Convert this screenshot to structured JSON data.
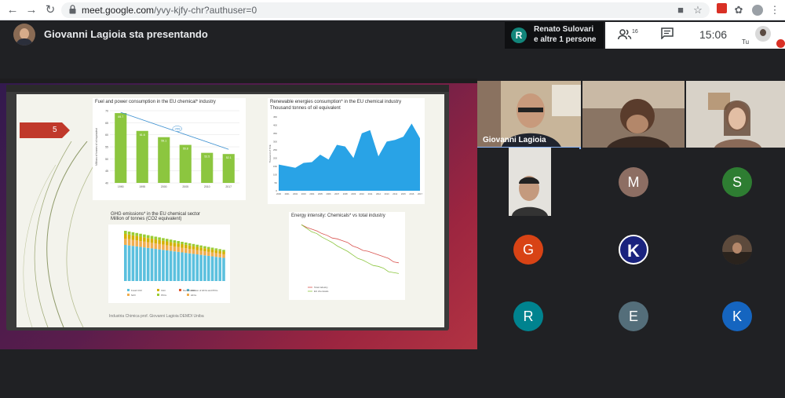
{
  "browser": {
    "url_host": "meet.google.com",
    "url_path": "/yvy-kjfy-chr?authuser=0"
  },
  "header": {
    "presenting_text": "Giovanni Lagioia sta presentando",
    "people_card": {
      "initial": "R",
      "line1": "Renato Sulovari",
      "line2": "e altre 1 persone"
    },
    "participants_count": "16",
    "clock": "15:06",
    "you_label": "Tu"
  },
  "slide": {
    "number": "5",
    "footer": "Industria Chimica   prof. Giovanni Lagioia DEMDI   Uniba",
    "charts": [
      {
        "type": "bar",
        "title": "Fuel and power consumption in the EU chemical* industry",
        "ylabel": "Millions of tonnes of oil equivalent",
        "categories": [
          "1990",
          "1995",
          "2000",
          "2005",
          "2010",
          "2017"
        ],
        "values": [
          69,
          61.6,
          59,
          55.8,
          52.5,
          52
        ],
        "ylim": [
          40,
          70
        ],
        "yticks": [
          "70",
          "65",
          "60",
          "55",
          "50",
          "45",
          "40"
        ],
        "bar_labels": [
          "69.7",
          "61.6",
          "59.1",
          "55.8",
          "52.5",
          "52.1"
        ],
        "color": "#8cc63f",
        "trend_label": "-25%"
      },
      {
        "type": "area",
        "title": "Renewable energies consumption* in the EU chemical industry",
        "subtitle": "Thousand tonnes of oil equivalent",
        "ylabel": "Thousand of TOE",
        "x": [
          "2000",
          "2001",
          "2002",
          "2003",
          "2004",
          "2005",
          "2006",
          "2007",
          "2008",
          "2009",
          "2010",
          "2011",
          "2012",
          "2013",
          "2014",
          "2015",
          "2016",
          "2017"
        ],
        "values": [
          160,
          150,
          140,
          170,
          175,
          220,
          190,
          280,
          270,
          200,
          350,
          370,
          210,
          300,
          310,
          330,
          410,
          320
        ],
        "ylim": [
          0,
          450
        ],
        "yticks": [
          "450",
          "400",
          "350",
          "300",
          "250",
          "200",
          "150",
          "100",
          "50",
          "0"
        ],
        "color": "#29a3e6"
      },
      {
        "type": "bar",
        "title": "GHG emissions* in the EU chemical sector",
        "subtitle": "Million of tonnes (CO2 equivalent)",
        "stacked": true,
        "series_colors": [
          "#5bc0de",
          "#f0ad4e",
          "#d4b106",
          "#9acd32"
        ],
        "legend": [
          "Fossil CO2",
          "N2O",
          "CH4",
          "PFCs",
          "SF6",
          "HFCs",
          "Decarbonisation of HFCs and PFCs"
        ]
      },
      {
        "type": "line",
        "title": "Energy intensity: Chemicals* vs total industry",
        "series": [
          {
            "name": "Total industry",
            "color": "#d9534f"
          },
          {
            "name": "EU chemicals",
            "color": "#8cc63f"
          }
        ]
      }
    ]
  },
  "tiles": [
    {
      "name": "Giovanni Lagioia",
      "kind": "video"
    },
    {
      "kind": "video"
    },
    {
      "kind": "video"
    },
    {
      "kind": "video"
    },
    {
      "initial": "M",
      "color": "#8d6e63"
    },
    {
      "initial": "S",
      "color": "#2e7d32"
    },
    {
      "initial": "G",
      "color": "#d84315"
    },
    {
      "initial": "K",
      "color": "#1a237e"
    },
    {
      "kind": "photo"
    },
    {
      "initial": "R",
      "color": "#00838f"
    },
    {
      "initial": "E",
      "color": "#546e7a"
    },
    {
      "initial": "K",
      "color": "#1565c0"
    }
  ]
}
